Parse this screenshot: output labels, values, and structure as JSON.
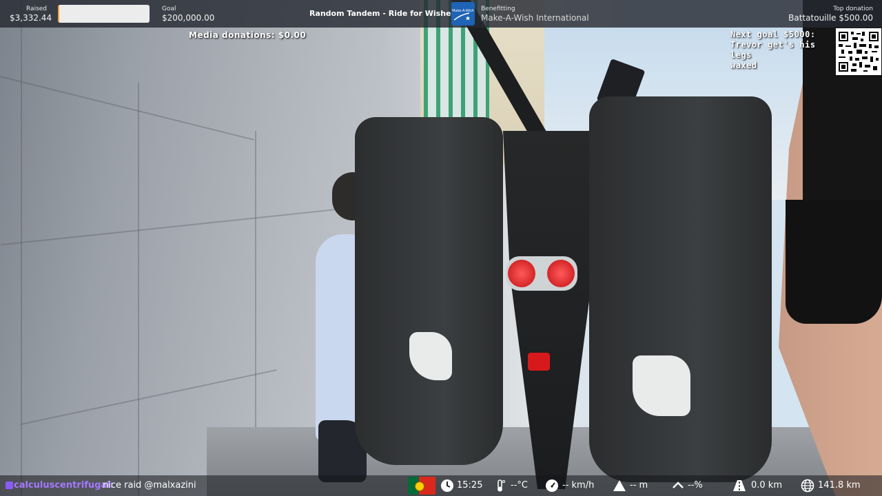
{
  "top_bar": {
    "raised_label": "Raised",
    "raised_value": "$3,332.44",
    "progress_fraction": 0.017,
    "goal_label": "Goal",
    "goal_value": "$200,000.00",
    "stream_title": "Random Tandem - Ride for Wishes",
    "benefitting_label": "Benefitting",
    "benefitting_value": "Make-A-Wish International",
    "logo_text": "Make-A-Wish",
    "top_donation_label": "Top donation",
    "top_donation_value": "Battatouille $500.00"
  },
  "media_donations": "Media donations: $0.00",
  "next_goal": {
    "line1": "Next goal $5000:",
    "line2": "Trevor get's his legs",
    "line3": "waxed"
  },
  "chat": {
    "username": "calculuscentrifugal:",
    "message": "nice raid @malxazini"
  },
  "stats": {
    "time": "15:25",
    "temperature": "--°C",
    "speed": "-- km/h",
    "altitude": "-- m",
    "grade": "--%",
    "distance_today": "0.0 km",
    "distance_total": "141.8 km"
  },
  "icons": [
    "portugal-flag-icon",
    "clock-icon",
    "thermometer-icon",
    "speedometer-icon",
    "mountain-icon",
    "chevron-up-icon",
    "road-icon",
    "globe-icon",
    "qr-code-icon"
  ],
  "colors": {
    "progress_fill": "#f0a02c",
    "chat_username": "#a679ff",
    "logo_blue": "#1e63b5"
  }
}
